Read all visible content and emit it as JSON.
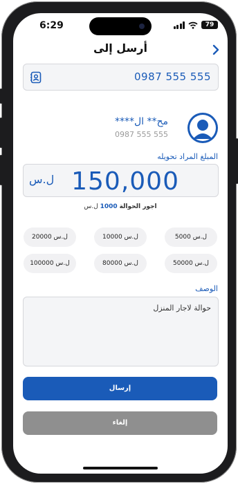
{
  "status_bar": {
    "time": "6:29",
    "battery": "79"
  },
  "header": {
    "title": "أرسل إلى"
  },
  "phone_field": {
    "value": "0987 555 555"
  },
  "recipient": {
    "name": "مح** ال****",
    "phone": "0987 555 555"
  },
  "amount": {
    "label": "المبلغ المراد تحويله",
    "value": "150,000",
    "currency": "ل.س"
  },
  "fee": {
    "prefix": "اجور الحوالة",
    "amount": "1000",
    "currency": "ل.س"
  },
  "quick_amounts": [
    "5000 ل.س",
    "10000 ل.س",
    "20000 ل.س",
    "50000 ل.س",
    "80000 ل.س",
    "100000 ل.س"
  ],
  "description": {
    "label": "الوصف",
    "value": "حوالة لاجار المنزل"
  },
  "buttons": {
    "send": "إرسال",
    "cancel": "إلغاء"
  },
  "colors": {
    "primary": "#1a5bb8",
    "cancel": "#8f8f8f"
  }
}
